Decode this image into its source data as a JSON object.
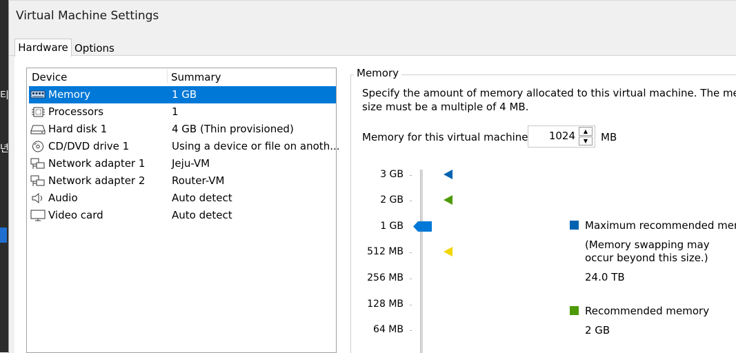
{
  "background_app": {
    "fragments": [
      "티",
      "년"
    ]
  },
  "window": {
    "title": "Virtual Machine Settings"
  },
  "tabs": [
    {
      "label": "Hardware",
      "active": true
    },
    {
      "label": "Options",
      "active": false
    }
  ],
  "device_list": {
    "columns": [
      "Device",
      "Summary"
    ],
    "rows": [
      {
        "icon": "memory-icon",
        "device": "Memory",
        "summary": "1 GB",
        "selected": true
      },
      {
        "icon": "processor-icon",
        "device": "Processors",
        "summary": "1",
        "selected": false
      },
      {
        "icon": "hard-disk-icon",
        "device": "Hard disk 1",
        "summary": "4 GB (Thin provisioned)",
        "selected": false
      },
      {
        "icon": "cd-dvd-icon",
        "device": "CD/DVD drive 1",
        "summary": "Using a device or file on anoth...",
        "selected": false
      },
      {
        "icon": "network-adapter-icon",
        "device": "Network adapter 1",
        "summary": "Jeju-VM",
        "selected": false
      },
      {
        "icon": "network-adapter-icon",
        "device": "Network adapter 2",
        "summary": "Router-VM",
        "selected": false
      },
      {
        "icon": "audio-icon",
        "device": "Audio",
        "summary": "Auto detect",
        "selected": false
      },
      {
        "icon": "video-card-icon",
        "device": "Video card",
        "summary": "Auto detect",
        "selected": false
      }
    ]
  },
  "memory": {
    "group_title": "Memory",
    "description_line1": "Specify the amount of memory allocated to this virtual machine. The memor",
    "description_line2": "size must be a multiple of 4 MB.",
    "field_label": "Memory for this virtual machine:",
    "field_value": "1024",
    "unit": "MB",
    "slider_ticks": [
      "3 GB",
      "2 GB",
      "1 GB",
      "512 MB",
      "256 MB",
      "128 MB",
      "64 MB"
    ],
    "current_value_label": "1 GB",
    "markers": {
      "max_recommended": {
        "tick": "3 GB",
        "color": "#0063b1"
      },
      "recommended": {
        "tick": "2 GB",
        "color": "#4e9a06"
      },
      "guest_min": {
        "tick": "512 MB",
        "color": "#f2d600"
      }
    },
    "legend": {
      "max_recommended_label": "Maximum recommended memo",
      "max_recommended_note1": "(Memory swapping may",
      "max_recommended_note2": "occur beyond this size.)",
      "max_recommended_value": "24.0 TB",
      "recommended_label": "Recommended memory",
      "recommended_value": "2 GB"
    }
  },
  "colors": {
    "selection": "#0078d7",
    "thumb": "#0078d7"
  }
}
